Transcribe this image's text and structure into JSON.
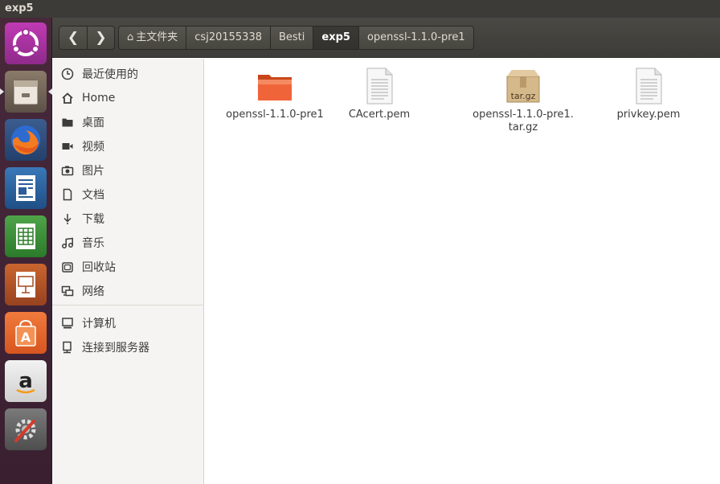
{
  "window": {
    "title": "exp5"
  },
  "launcher": {
    "items": [
      {
        "name": "ubuntu-dash"
      },
      {
        "name": "files"
      },
      {
        "name": "firefox"
      },
      {
        "name": "libreoffice-writer"
      },
      {
        "name": "libreoffice-calc"
      },
      {
        "name": "libreoffice-impress"
      },
      {
        "name": "ubuntu-software"
      },
      {
        "name": "amazon"
      },
      {
        "name": "system-settings"
      }
    ]
  },
  "toolbar": {
    "back_glyph": "❮",
    "forward_glyph": "❯",
    "breadcrumbs": [
      "主文件夹",
      "csj20155338",
      "Besti",
      "exp5",
      "openssl-1.1.0-pre1"
    ],
    "active_crumb": "exp5"
  },
  "sidebar": {
    "items": [
      {
        "label": "最近使用的",
        "icon": "clock-icon"
      },
      {
        "label": "Home",
        "icon": "home-icon"
      },
      {
        "label": "桌面",
        "icon": "folder-icon"
      },
      {
        "label": "视频",
        "icon": "video-icon"
      },
      {
        "label": "图片",
        "icon": "camera-icon"
      },
      {
        "label": "文档",
        "icon": "document-icon"
      },
      {
        "label": "下载",
        "icon": "download-icon"
      },
      {
        "label": "音乐",
        "icon": "music-icon"
      },
      {
        "label": "回收站",
        "icon": "trash-icon"
      },
      {
        "label": "网络",
        "icon": "network-icon"
      }
    ],
    "devices": [
      {
        "label": "计算机",
        "icon": "computer-icon"
      },
      {
        "label": "连接到服务器",
        "icon": "server-icon"
      }
    ]
  },
  "files": [
    {
      "name": "openssl-1.1.0-pre1",
      "type": "folder"
    },
    {
      "name": "CAcert.pem",
      "type": "text"
    },
    {
      "name": "openssl-1.1.0-pre1.tar.gz",
      "name_line1": "openssl-1.1.0-pre1.",
      "name_line2": "tar.gz",
      "type": "archive",
      "badge": "tar.gz"
    },
    {
      "name": "privkey.pem",
      "type": "text"
    }
  ],
  "colors": {
    "accent_folder": "#e95420",
    "launcher_bg": "#47293a",
    "toolbar_bg": "#3d3c38"
  }
}
